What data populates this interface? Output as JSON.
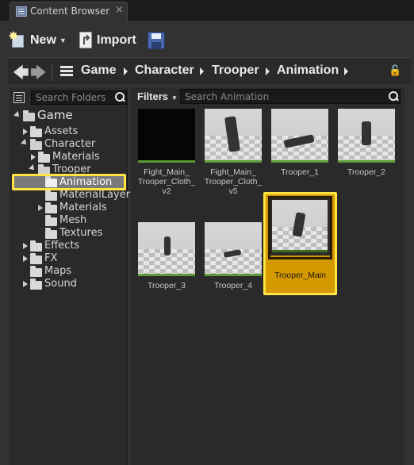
{
  "tab": {
    "title": "Content Browser",
    "close": "×"
  },
  "toolbar": {
    "new_label": "New",
    "import_label": "Import"
  },
  "path": {
    "crumbs": [
      "Game",
      "Character",
      "Trooper",
      "Animation"
    ]
  },
  "folders": {
    "search_placeholder": "Search Folders",
    "items": [
      {
        "label": "Game"
      },
      {
        "label": "Assets"
      },
      {
        "label": "Character"
      },
      {
        "label": "Materials"
      },
      {
        "label": "Trooper"
      },
      {
        "label": "Animation"
      },
      {
        "label": "MaterialLayer"
      },
      {
        "label": "Materials"
      },
      {
        "label": "Mesh"
      },
      {
        "label": "Textures"
      },
      {
        "label": "Effects"
      },
      {
        "label": "FX"
      },
      {
        "label": "Maps"
      },
      {
        "label": "Sound"
      }
    ],
    "selected": "Animation"
  },
  "content": {
    "filters_label": "Filters",
    "search_placeholder": "Search Animation",
    "assets": [
      {
        "label": "Fight_Main_ Trooper_Cloth_ v2"
      },
      {
        "label": "Fight_Main_ Trooper_Cloth_ v5"
      },
      {
        "label": "Trooper_1"
      },
      {
        "label": "Trooper_2"
      },
      {
        "label": "Trooper_3"
      },
      {
        "label": "Trooper_4"
      },
      {
        "label": "Trooper_Main"
      }
    ],
    "selected": "Trooper_Main"
  },
  "colors": {
    "highlight": "#ffe342",
    "selection": "#d49800",
    "accent_green": "#5b9a36"
  }
}
